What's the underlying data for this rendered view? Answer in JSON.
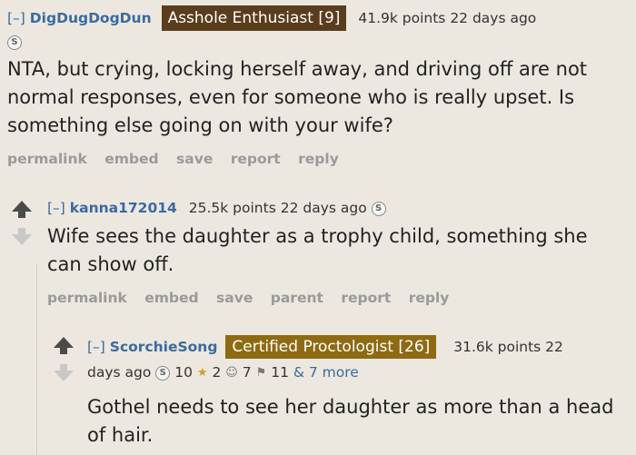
{
  "comment1": {
    "toggle": "[–]",
    "author": "DigDugDogDun",
    "flair": "Asshole Enthusiast [9]",
    "points": "41.9k points",
    "age": "22 days ago",
    "award_icon": "silver-award-icon",
    "body": "NTA, but crying, locking herself away, and driving off are not normal responses, even for someone who is really upset. Is something else going on with your wife?",
    "actions": [
      "permalink",
      "embed",
      "save",
      "report",
      "reply"
    ]
  },
  "comment2": {
    "toggle": "[–]",
    "author": "kanna172014",
    "points": "25.5k points",
    "age": "22 days ago",
    "award_icon": "silver-award-icon",
    "body": "Wife sees the daughter as a trophy child, something she can show off.",
    "actions": [
      "permalink",
      "embed",
      "save",
      "parent",
      "report",
      "reply"
    ]
  },
  "comment3": {
    "toggle": "[–]",
    "author": "ScorchieSong",
    "flair": "Certified Proctologist [26]",
    "points": "31.6k points 22",
    "age": "days ago",
    "awards": [
      {
        "icon": "silver-award-icon",
        "count": "10"
      },
      {
        "icon": "gold-award-icon",
        "count": "2"
      },
      {
        "icon": "wholesome-award-icon",
        "count": "7"
      },
      {
        "icon": "helpful-award-icon",
        "count": "11"
      }
    ],
    "more_awards": "& 7 more",
    "body": "Gothel needs to see her daughter as more than a head of hair."
  },
  "colors": {
    "background": "#ece8e0",
    "link_blue": "#3b6aa0",
    "flair_dark": "#5a3d1c",
    "flair_gold": "#8e6a12",
    "action_gray": "#9a9a9a"
  }
}
